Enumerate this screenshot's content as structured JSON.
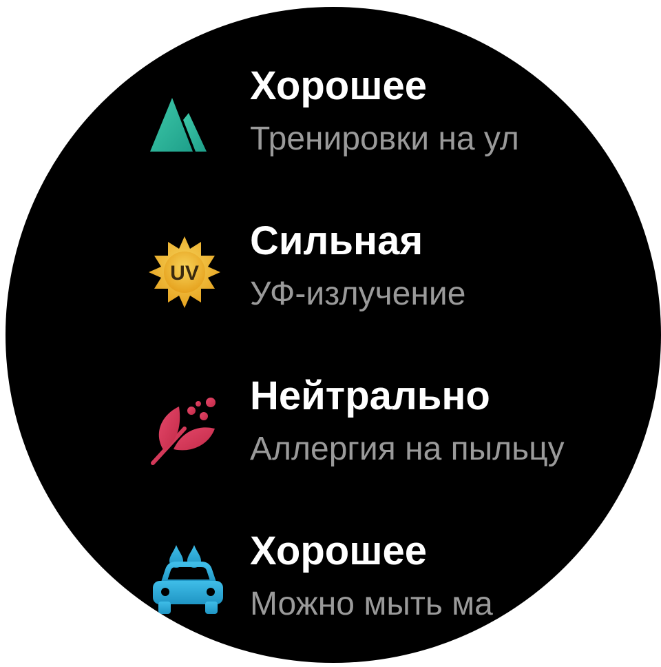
{
  "items": [
    {
      "title": "Хорошее",
      "subtitle": "Тренировки на ул",
      "icon": "mountain-icon",
      "color": "#2fb59c"
    },
    {
      "title": "Сильная",
      "subtitle": "УФ-излучение",
      "icon": "uv-sun-icon",
      "icon_text": "UV",
      "color": "#f0b429"
    },
    {
      "title": "Нейтрально",
      "subtitle": "Аллергия на пыльцу",
      "icon": "pollen-leaf-icon",
      "color": "#e03a5a"
    },
    {
      "title": "Хорошее",
      "subtitle": "Можно мыть ма",
      "icon": "car-wash-icon",
      "color": "#2aa8d8"
    }
  ]
}
